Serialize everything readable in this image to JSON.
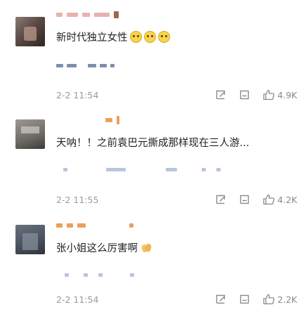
{
  "comments": [
    {
      "text": "新时代独立女性",
      "emoji_count": 3,
      "emoji_icon": "grinning-face-emoji",
      "time": "2-2 11:54",
      "likes": "4.9K"
    },
    {
      "text": "天呐！！之前袁巴元撕成那样现在三人游...",
      "time": "2-2 11:55",
      "likes": "4.2K"
    },
    {
      "text": "张小姐这么厉害啊",
      "emoji_icon": "clapping-hands-emoji",
      "time": "2-2 11:54",
      "likes": "2.2K"
    }
  ],
  "icons": {
    "reply": "reply-icon",
    "share": "share-icon",
    "like": "thumbs-up-icon"
  },
  "colors": {
    "text": "#222222",
    "meta": "#9a9a9a",
    "icon": "#8a8a8a",
    "emoji": "#f7d44a"
  }
}
